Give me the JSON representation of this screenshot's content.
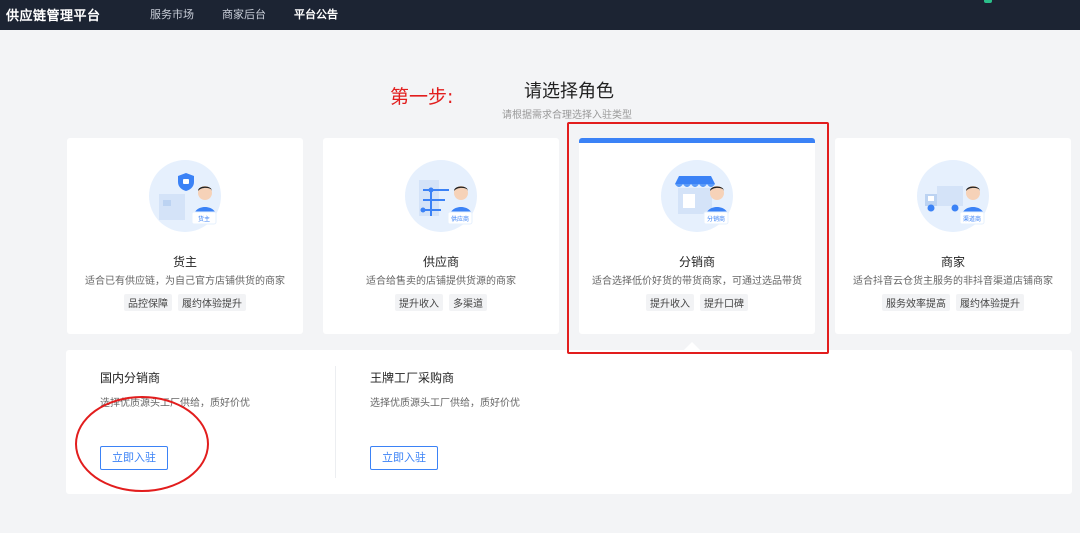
{
  "header": {
    "brand": "供应链管理平台",
    "nav": [
      {
        "label": "服务市场",
        "active": false
      },
      {
        "label": "商家后台",
        "active": false
      },
      {
        "label": "平台公告",
        "active": true
      }
    ]
  },
  "annotation": {
    "step_label": "第一步:"
  },
  "page": {
    "title": "请选择角色",
    "subtitle": "请根据需求合理选择入驻类型"
  },
  "roles": [
    {
      "title": "货主",
      "badge": "货主",
      "desc": "适合已有供应链，为自己官方店铺供货的商家",
      "tags": [
        "品控保障",
        "履约体验提升"
      ],
      "icon": "shield-bag-icon",
      "selected": false
    },
    {
      "title": "供应商",
      "badge": "供应商",
      "desc": "适合给售卖的店铺提供货源的商家",
      "tags": [
        "提升收入",
        "多渠道"
      ],
      "icon": "network-icon",
      "selected": false
    },
    {
      "title": "分销商",
      "badge": "分销商",
      "desc": "适合选择低价好货的带货商家，可通过选品带货",
      "tags": [
        "提升收入",
        "提升口碑"
      ],
      "icon": "storefront-icon",
      "selected": true
    },
    {
      "title": "商家",
      "badge": "渠道商",
      "desc": "适合抖音云仓货主服务的非抖音渠道店铺商家",
      "tags": [
        "服务效率提高",
        "履约体验提升"
      ],
      "icon": "truck-icon",
      "selected": false
    }
  ],
  "options": [
    {
      "title": "国内分销商",
      "desc": "选择优质源头工厂供给，质好价优",
      "button": "立即入驻"
    },
    {
      "title": "王牌工厂采购商",
      "desc": "选择优质源头工厂供给，质好价优",
      "button": "立即入驻"
    }
  ],
  "colors": {
    "accent": "#3b82f6",
    "annotation": "#e21d1d",
    "header_bg": "#1c2433"
  }
}
